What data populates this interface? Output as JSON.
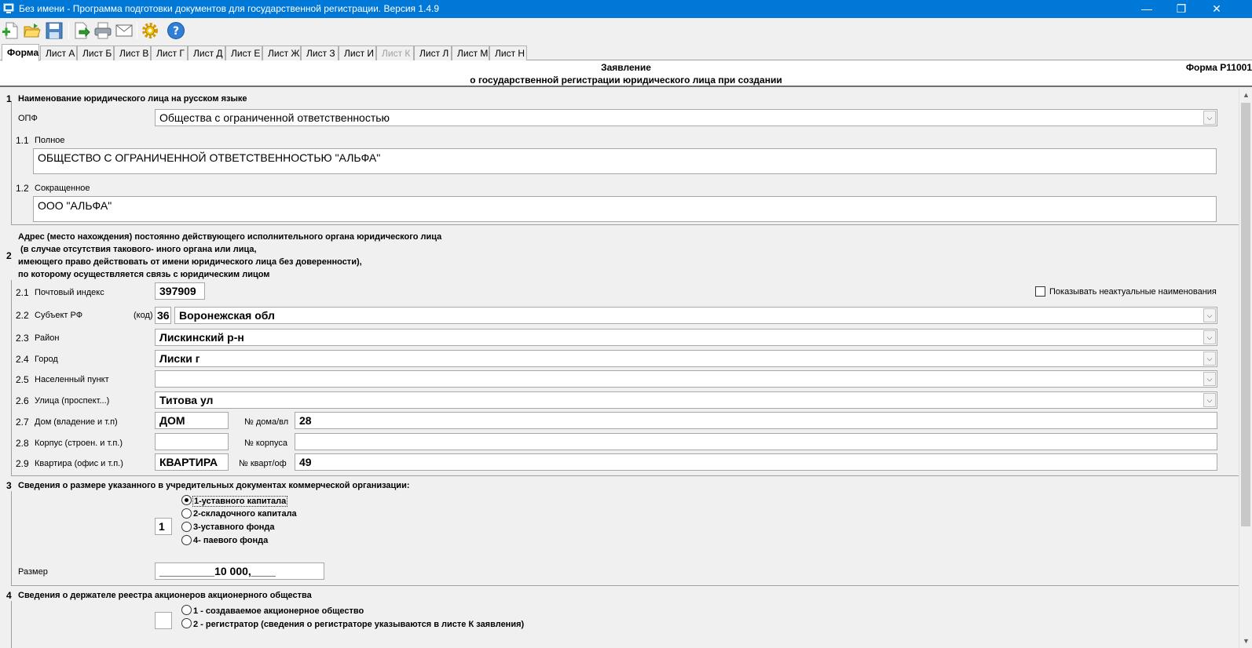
{
  "window": {
    "title": "Без имени - Программа подготовки документов для государственной регистрации. Версия 1.4.9",
    "controls": {
      "minimize": "—",
      "maximize": "❐",
      "close": "✕"
    }
  },
  "toolbar": {
    "buttons": [
      {
        "icon": "new-document-icon"
      },
      {
        "icon": "open-folder-icon"
      },
      {
        "icon": "save-icon"
      },
      {
        "icon": "export-icon"
      },
      {
        "icon": "print-icon"
      },
      {
        "icon": "email-icon"
      },
      {
        "icon": "settings-gear-icon"
      },
      {
        "icon": "help-icon"
      }
    ]
  },
  "tabs": [
    {
      "label": "Форма",
      "active": true
    },
    {
      "label": "Лист А"
    },
    {
      "label": "Лист Б"
    },
    {
      "label": "Лист В"
    },
    {
      "label": "Лист Г"
    },
    {
      "label": "Лист Д"
    },
    {
      "label": "Лист Е"
    },
    {
      "label": "Лист Ж"
    },
    {
      "label": "Лист З"
    },
    {
      "label": "Лист И"
    },
    {
      "label": "Лист К",
      "disabled": true
    },
    {
      "label": "Лист Л"
    },
    {
      "label": "Лист М"
    },
    {
      "label": "Лист Н"
    }
  ],
  "header": {
    "line1": "Заявление",
    "line2": "о государственной регистрации юридического лица при создании",
    "form_name": "Форма Р11001"
  },
  "section1": {
    "num": "1",
    "title": "Наименование юридического лица на русском языке",
    "opf_label": "ОПФ",
    "opf_value": "Общества с ограниченной ответственностью",
    "full_num": "1.1",
    "full_label": "Полное",
    "full_value": "ОБЩЕСТВО С ОГРАНИЧЕННОЙ ОТВЕТСТВЕННОСТЬЮ \"АЛЬФА\"",
    "short_num": "1.2",
    "short_label": "Сокращенное",
    "short_value": "ООО \"АЛЬФА\""
  },
  "section2": {
    "num": "2",
    "title_lines": [
      "Адрес (место нахождения) постоянно действующего исполнительного органа юридического лица",
      " (в случае отсутствия такового- иного органа или лица,",
      "имеющего право действовать от имени юридического лица без доверенности),",
      "по которому осуществляется связь с юридическим лицом"
    ],
    "show_inactive_label": "Показывать неактуальные наименования",
    "postal": {
      "num": "2.1",
      "label": "Почтовый индекс",
      "value": "397909"
    },
    "subject": {
      "num": "2.2",
      "label": "Субъект РФ",
      "code_label": "(код)",
      "code": "36",
      "value": "Воронежская обл"
    },
    "district": {
      "num": "2.3",
      "label": "Район",
      "value": "Лискинский р-н"
    },
    "city": {
      "num": "2.4",
      "label": "Город",
      "value": "Лиски г"
    },
    "settlement": {
      "num": "2.5",
      "label": "Населенный пункт",
      "value": ""
    },
    "street": {
      "num": "2.6",
      "label": "Улица (проспект...)",
      "value": "Титова ул"
    },
    "house": {
      "num": "2.7",
      "label": "Дом (владение и т.п)",
      "type": "ДОМ",
      "no_label": "№ дома/вл",
      "no": "28"
    },
    "building": {
      "num": "2.8",
      "label": "Корпус (строен. и т.п.)",
      "type": "",
      "no_label": "№ корпуса",
      "no": ""
    },
    "apartment": {
      "num": "2.9",
      "label": "Квартира (офис и т.п.)",
      "type": "КВАРТИРА",
      "no_label": "№ кварт/оф",
      "no": "49"
    }
  },
  "section3": {
    "num": "3",
    "title": "Сведения о размере указанного в учредительных документах коммерческой организации:",
    "code": "1",
    "options": [
      "1-уставного капитала",
      "2-складочного капитала",
      "3-уставного фонда",
      "4- паевого фонда"
    ],
    "selected": 0,
    "size_label": "Размер",
    "size_value": "_________10 000,____"
  },
  "section4": {
    "num": "4",
    "title": "Сведения о держателе реестра акционеров акционерного общества",
    "code": "",
    "options": [
      "1 - создаваемое акционерное общество",
      "2 - регистратор (сведения о регистраторе указываются в листе К заявления)"
    ]
  },
  "scrollbar": {
    "up": "▲",
    "down": "▼"
  },
  "combo_arrow": "⌵"
}
